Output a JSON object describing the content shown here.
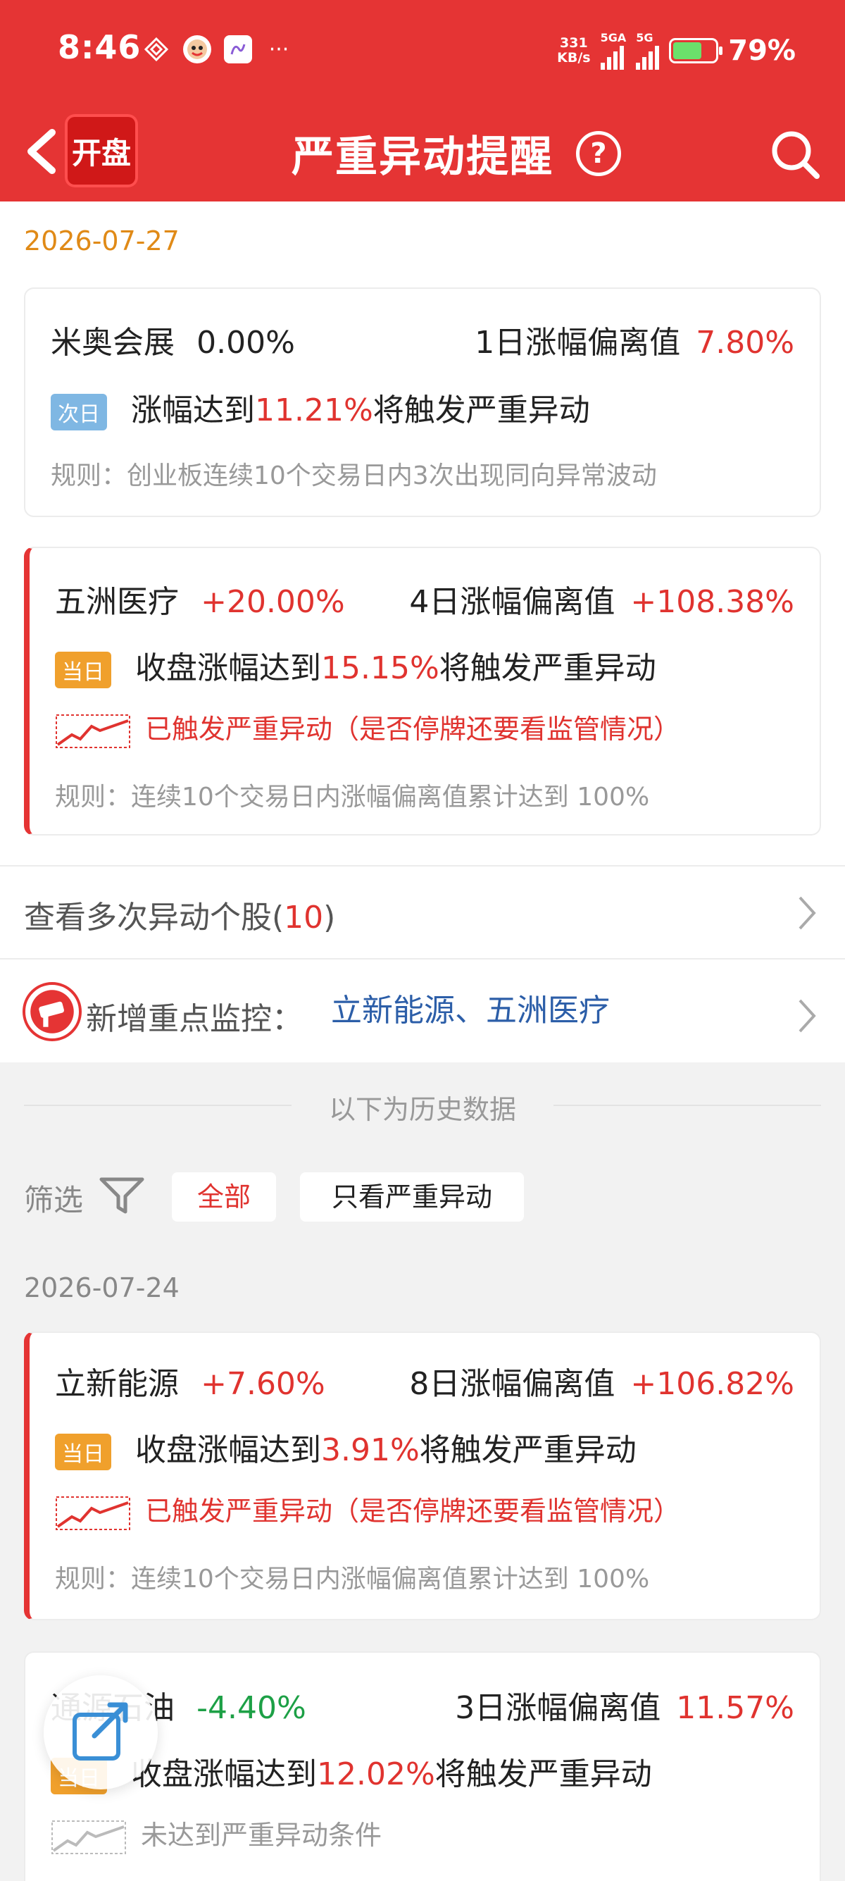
{
  "status_bar": {
    "time": "8:46",
    "net_speed_top": "331",
    "net_speed_unit": "KB/s",
    "sim1_label": "5GA",
    "sim2_label": "5G",
    "battery": "79%",
    "more": "···"
  },
  "header": {
    "logo_text": "开盘",
    "title": "严重异动提醒",
    "help": "?"
  },
  "today": {
    "date": "2026-07-27",
    "cards": [
      {
        "name": "米奥会展",
        "change": "0.00%",
        "dev_label": "1日涨幅偏离值",
        "dev_value": "7.80%",
        "tag": "次日",
        "trigger_pre": "涨幅达到",
        "trigger_value": "11.21%",
        "trigger_post": "将触发严重异动",
        "rule": "规则：创业板连续10个交易日内3次出现同向异常波动"
      },
      {
        "name": "五洲医疗",
        "change": "+20.00%",
        "dev_label": "4日涨幅偏离值",
        "dev_value": "+108.38%",
        "tag": "当日",
        "trigger_pre": "收盘涨幅达到",
        "trigger_value": "15.15%",
        "trigger_post": "将触发严重异动",
        "status": "已触发严重异动（是否停牌还要看监管情况）",
        "rule": "规则：连续10个交易日内涨幅偏离值累计达到 100%"
      }
    ]
  },
  "more_stocks": {
    "label": "查看多次异动个股(",
    "count": "10",
    "close": ")"
  },
  "monitor": {
    "label": "新增重点监控：",
    "stocks": "立新能源、五洲医疗"
  },
  "history": {
    "title": "以下为历史数据",
    "filter_label": "筛选",
    "filter_all": "全部",
    "filter_severe": "只看严重异动",
    "date": "2026-07-24",
    "cards": [
      {
        "name": "立新能源",
        "change": "+7.60%",
        "dev_label": "8日涨幅偏离值",
        "dev_value": "+106.82%",
        "tag": "当日",
        "trigger_pre": "收盘涨幅达到",
        "trigger_value": "3.91%",
        "trigger_post": "将触发严重异动",
        "status": "已触发严重异动（是否停牌还要看监管情况）",
        "rule": "规则：连续10个交易日内涨幅偏离值累计达到 100%"
      },
      {
        "name": "通源石油",
        "change": "-4.40%",
        "dev_label": "3日涨幅偏离值",
        "dev_value": "11.57%",
        "tag": "当日",
        "trigger_pre": "收盘涨幅达到",
        "trigger_value": "12.02%",
        "trigger_post": "将触发严重异动",
        "status": "未达到严重异动条件"
      }
    ]
  },
  "colors": {
    "brand_red": "#e53434",
    "up_red": "#e0332f",
    "down_green": "#1da046",
    "date_orange": "#e08a17",
    "link_blue": "#2c5ea8"
  }
}
